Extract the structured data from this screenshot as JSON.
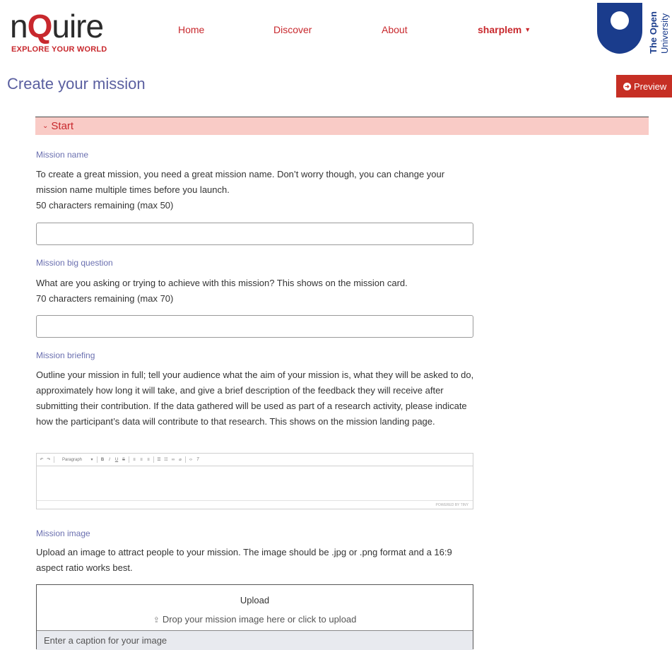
{
  "brand": {
    "name_pre": "n",
    "name_q": "Q",
    "name_post": "uire",
    "tagline": "EXPLORE YOUR WORLD"
  },
  "nav": {
    "home": "Home",
    "discover": "Discover",
    "about": "About",
    "user": "sharplem"
  },
  "university": {
    "line1": "The Open",
    "line2": "University"
  },
  "page": {
    "title": "Create your mission",
    "preview_label": "Preview"
  },
  "section": {
    "title": "Start"
  },
  "fields": {
    "name": {
      "label": "Mission name",
      "help_1": "To create a great mission, you need a great mission name. Don’t worry though, you can change your mission name multiple times before you launch.",
      "help_2": "50 characters remaining (max 50)",
      "value": ""
    },
    "question": {
      "label": "Mission big question",
      "help_1": "What are you asking or trying to achieve with this mission? This shows on the mission card.",
      "help_2": "70 characters remaining (max 70)",
      "value": ""
    },
    "briefing": {
      "label": "Mission briefing",
      "help": "Outline your mission in full; tell your audience what the aim of your mission is, what they will be asked to do, approximately how long it will take, and give a brief description of the feedback they will receive after submitting their contribution. If the data gathered will be used as part of a research activity, please indicate how the participant’s data will contribute to that research. This shows on the mission landing page.",
      "toolbar_paragraph": "Paragraph",
      "status_text": "POWERED BY TINY"
    },
    "image": {
      "label": "Mission image",
      "help": "Upload an image to attract people to your mission. The image should be .jpg or .png format and a 16:9 aspect ratio works best.",
      "upload_title": "Upload",
      "drop_text": "Drop your mission image here or click to upload",
      "caption_placeholder": "Enter a caption for your image"
    }
  },
  "colors": {
    "brand_red": "#c8282d",
    "ou_blue": "#1a3c8c",
    "section_bg": "#f9cbc6",
    "label_purple": "#6b70b0"
  }
}
